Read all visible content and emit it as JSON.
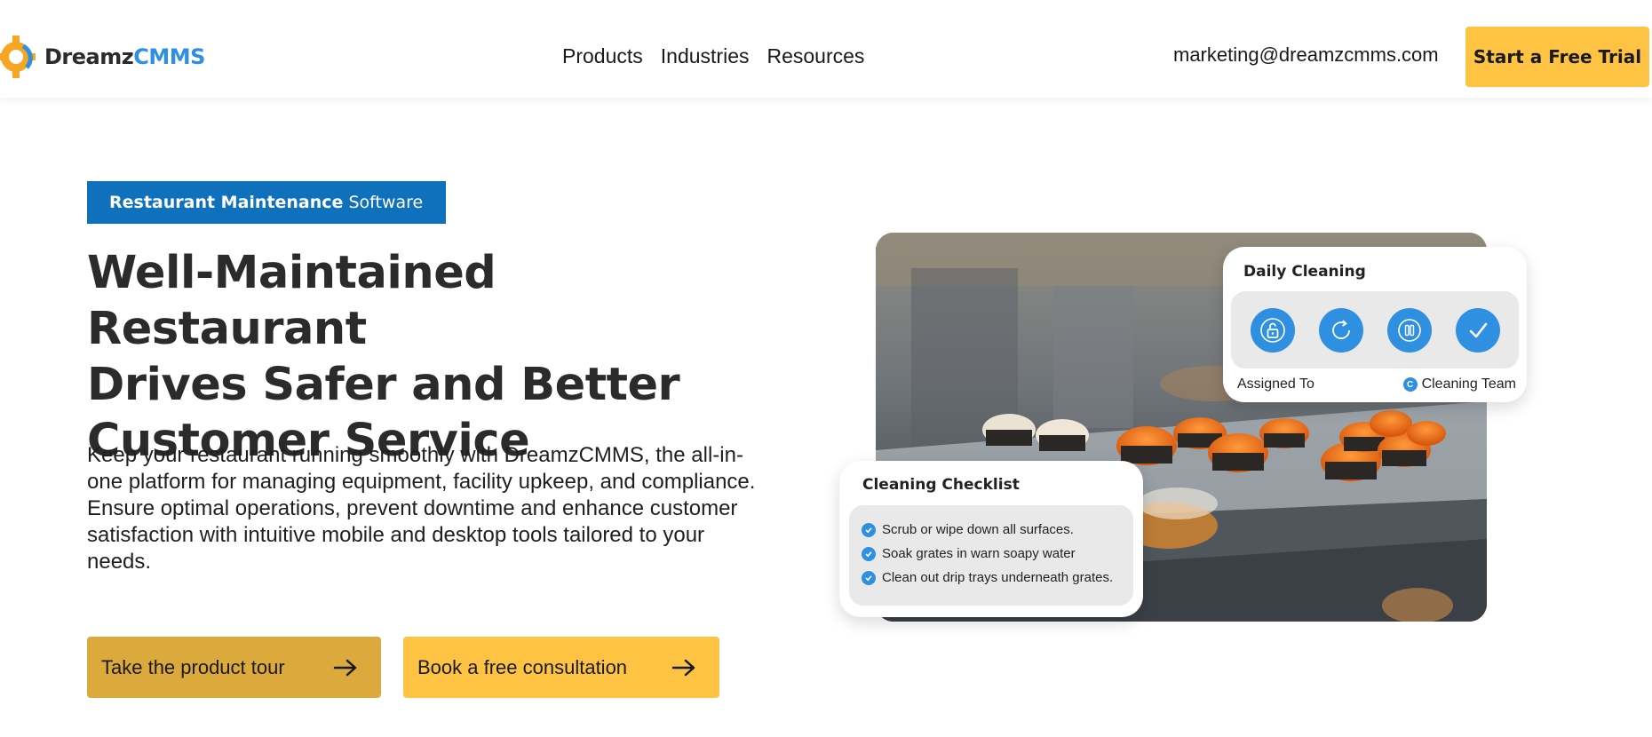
{
  "header": {
    "logo": {
      "part1": "Dreamz",
      "part2": "CMMS"
    },
    "nav": [
      {
        "label": "Products"
      },
      {
        "label": "Industries"
      },
      {
        "label": "Resources"
      }
    ],
    "email": "marketing@dreamzcmms.com",
    "trial_label": "Start a Free Trial"
  },
  "hero": {
    "tag": {
      "bold": "Restaurant Maintenance",
      "regular": "Software"
    },
    "headline_lines": [
      "Well-Maintained Restaurant",
      "Drives Safer and Better",
      "Customer Service"
    ],
    "body": "Keep your restaurant running smoothly with DreamzCMMS, the all-in-one platform for managing equipment, facility upkeep, and compliance. Ensure optimal operations, prevent downtime and enhance customer satisfaction with intuitive mobile and desktop tools tailored to your needs.",
    "cta_tour": "Take the product tour",
    "cta_consult": "Book a free consultation"
  },
  "daily_card": {
    "title": "Daily Cleaning",
    "status_icons": [
      "unlock-icon",
      "refresh-icon",
      "pause-icon",
      "checkmark-icon"
    ],
    "assigned_label": "Assigned To",
    "team_initial": "C",
    "team": "Cleaning Team"
  },
  "checklist_card": {
    "title": "Cleaning Checklist",
    "items": [
      "Scrub or wipe down all surfaces.",
      "Soak grates in warn soapy water",
      "Clean out drip trays underneath grates."
    ]
  },
  "colors": {
    "accent_yellow": "#ffc343",
    "accent_gold": "#dcaa3c",
    "brand_blue": "#0f71bc",
    "icon_blue": "#2f8fe0"
  }
}
